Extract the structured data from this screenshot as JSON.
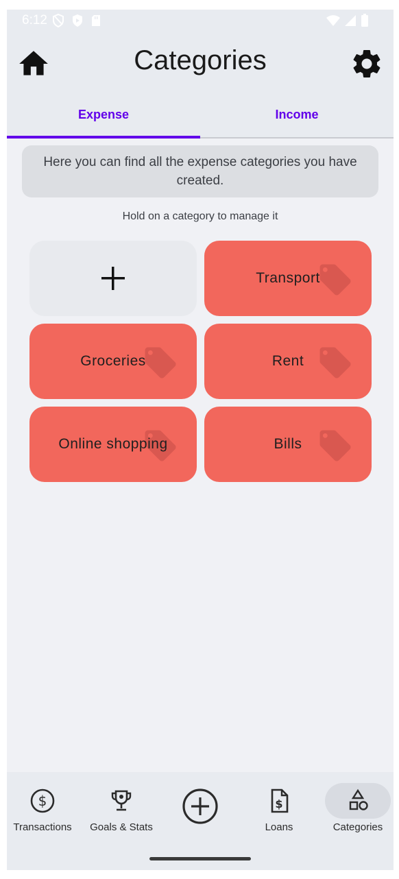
{
  "status_bar": {
    "time": "6:12"
  },
  "app_bar": {
    "title": "Categories"
  },
  "tabs": [
    {
      "label": "Expense",
      "selected": true
    },
    {
      "label": "Income",
      "selected": false
    }
  ],
  "info_text": "Here you can find all the expense categories you have created.",
  "hint_text": "Hold on a category to manage it",
  "categories": [
    {
      "label": "Transport",
      "icon": "tag-icon"
    },
    {
      "label": "Groceries",
      "icon": "tag-icon"
    },
    {
      "label": "Rent",
      "icon": "tag-icon"
    },
    {
      "label": "Online shopping",
      "icon": "tag-icon"
    },
    {
      "label": "Bills",
      "icon": "tag-icon"
    }
  ],
  "colors": {
    "accent": "#6200ea",
    "category_tile": "#f2675c",
    "tag_icon": "#d95850"
  },
  "bottom_nav": {
    "items": [
      {
        "label": "Transactions",
        "icon": "dollar-circle-icon"
      },
      {
        "label": "Goals & Stats",
        "icon": "trophy-icon"
      },
      {
        "label": "",
        "icon": "add-circle-icon"
      },
      {
        "label": "Loans",
        "icon": "invoice-icon"
      },
      {
        "label": "Categories",
        "icon": "shapes-icon",
        "selected": true
      }
    ]
  }
}
